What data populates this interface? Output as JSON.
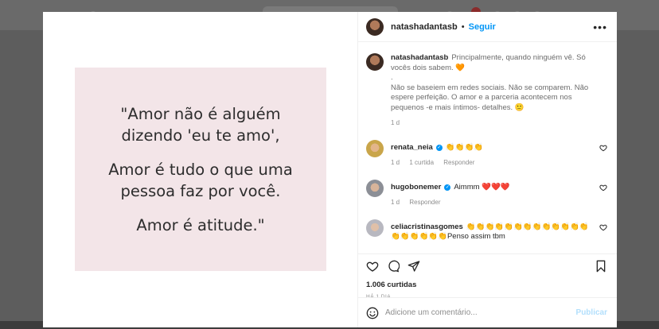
{
  "post": {
    "username": "natashadantasb",
    "separator": "•",
    "follow_label": "Seguir",
    "more_label": "•••",
    "quote": {
      "line1": "\"Amor não é alguém",
      "line2": "dizendo 'eu te amo',",
      "line3": "Amor é tudo o que uma",
      "line4": "pessoa faz por você.",
      "line5": "Amor é atitude.\""
    },
    "caption": {
      "username": "natashadantasb",
      "p1": "Principalmente, quando ninguém vê. Só vocês dois sabem. 🧡",
      "p2": ".",
      "p3": "Não se baseiem em redes sociais. Não se comparem. Não espere perfeição. O amor e a parceria acontecem nos pequenos -e mais íntimos- detalhes. 🙂",
      "time": "1 d"
    },
    "comments": [
      {
        "username": "renata_neia",
        "text": "👏👏👏👏",
        "time": "1 d",
        "likes": "1 curtida",
        "reply": "Responder"
      },
      {
        "username": "hugobonemer",
        "text": "Aimmm ❤️❤️❤️",
        "time": "1 d",
        "reply": "Responder"
      },
      {
        "username": "celiacristinasgomes",
        "text": "👏👏👏👏👏👏👏👏👏👏👏👏👏👏👏👏👏👏👏Penso assim tbm"
      }
    ],
    "likes_count": "1.006 curtidas",
    "posted_ago": "HÁ 1 DIA",
    "comment_placeholder": "Adicione um comentário...",
    "publish_label": "Publicar"
  },
  "icons": {
    "like": "heart-icon",
    "comment": "comment-icon",
    "share": "share-icon",
    "save": "bookmark-icon",
    "emoji": "emoji-icon",
    "verified": "verified-icon"
  },
  "colors": {
    "link_blue": "#0095f6",
    "publish_disabled": "#b2dffc",
    "quote_background": "#f3e5e8"
  }
}
